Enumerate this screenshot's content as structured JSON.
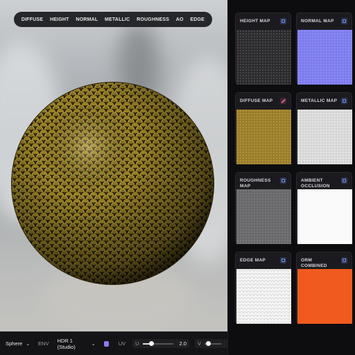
{
  "tabs": [
    "DIFFUSE",
    "HEIGHT",
    "NORMAL",
    "METALLIC",
    "ROUGHNESS",
    "AO",
    "EDGE"
  ],
  "bottom_bar": {
    "shape": "Sphere",
    "env_label": "ENV",
    "env_value": "HDR 1 (Studio)",
    "uv_label": "UV",
    "u_label": "U",
    "u_value": "2.0",
    "v_label": "V"
  },
  "maps": [
    {
      "title": "HEIGHT MAP",
      "icon": "map-icon",
      "color": "#2f2f31"
    },
    {
      "title": "NORMAL MAP",
      "icon": "map-icon",
      "color": "#7f7ef0"
    },
    {
      "title": "DIFFUSE MAP",
      "icon": "brush-icon",
      "color": "#9a7e2c"
    },
    {
      "title": "METALLIC MAP",
      "icon": "map-icon",
      "color": "#d9d9d9"
    },
    {
      "title": "ROUGHNESS MAP",
      "icon": "map-icon",
      "color": "#6b6b6d"
    },
    {
      "title": "AMBIENT OCCLUSION",
      "icon": "map-icon",
      "color": "#fafafa"
    },
    {
      "title": "EDGE MAP",
      "icon": "map-icon",
      "color": "#f4f4f4"
    },
    {
      "title": "ORM COMBINED",
      "icon": "map-icon",
      "color": "#f05a1e"
    }
  ],
  "colors": {
    "accent": "#7a8fe8",
    "scale_gold": "#8a7420"
  }
}
